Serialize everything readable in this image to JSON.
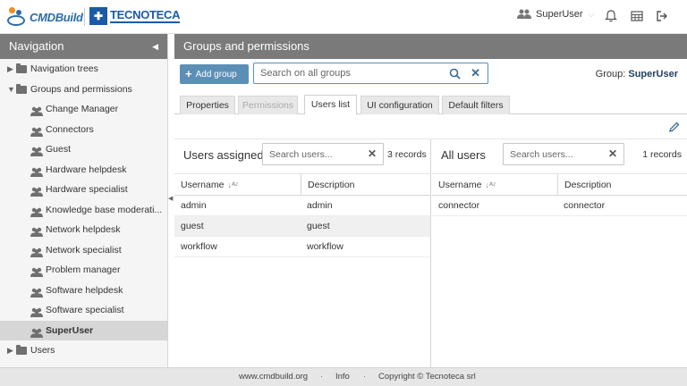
{
  "header": {
    "logo_left": "CMDBuild",
    "logo_right": "TECNOTECA",
    "user_name": "SuperUser"
  },
  "sidebar": {
    "title": "Navigation",
    "items": [
      {
        "label": "Navigation trees",
        "level": 0,
        "expanded": false
      },
      {
        "label": "Groups and permissions",
        "level": 0,
        "expanded": true
      },
      {
        "label": "Change Manager",
        "level": 1
      },
      {
        "label": "Connectors",
        "level": 1
      },
      {
        "label": "Guest",
        "level": 1
      },
      {
        "label": "Hardware helpdesk",
        "level": 1
      },
      {
        "label": "Hardware specialist",
        "level": 1
      },
      {
        "label": "Knowledge base moderati...",
        "level": 1
      },
      {
        "label": "Network helpdesk",
        "level": 1
      },
      {
        "label": "Network specialist",
        "level": 1
      },
      {
        "label": "Problem manager",
        "level": 1
      },
      {
        "label": "Software helpdesk",
        "level": 1
      },
      {
        "label": "Software specialist",
        "level": 1
      },
      {
        "label": "SuperUser",
        "level": 1,
        "selected": true
      },
      {
        "label": "Users",
        "level": 0,
        "expanded": false
      }
    ]
  },
  "main": {
    "title": "Groups and permissions",
    "add_group_label": "Add group",
    "search_placeholder": "Search on all groups",
    "group_prefix": "Group:",
    "group_name": "SuperUser",
    "tabs": [
      {
        "label": "Properties",
        "state": "normal"
      },
      {
        "label": "Permissions",
        "state": "disabled"
      },
      {
        "label": "Users list",
        "state": "active"
      },
      {
        "label": "UI configuration",
        "state": "normal"
      },
      {
        "label": "Default filters",
        "state": "normal"
      }
    ],
    "assigned": {
      "title": "Users assigned",
      "search_placeholder": "Search users...",
      "records": "3 records",
      "columns": [
        "Username",
        "Description"
      ],
      "rows": [
        [
          "admin",
          "admin"
        ],
        [
          "guest",
          "guest"
        ],
        [
          "workflow",
          "workflow"
        ]
      ]
    },
    "all_users": {
      "title": "All users",
      "search_placeholder": "Search users...",
      "records": "1 records",
      "columns": [
        "Username",
        "Description"
      ],
      "rows": [
        [
          "connector",
          "connector"
        ]
      ]
    }
  },
  "footer": {
    "site": "www.cmdbuild.org",
    "info": "Info",
    "copyright": "Copyright © Tecnoteca srl"
  },
  "colors": {
    "accent": "#5b8fb6",
    "header_bar": "#7a7a7a",
    "selected_row": "#d6d6d6"
  }
}
